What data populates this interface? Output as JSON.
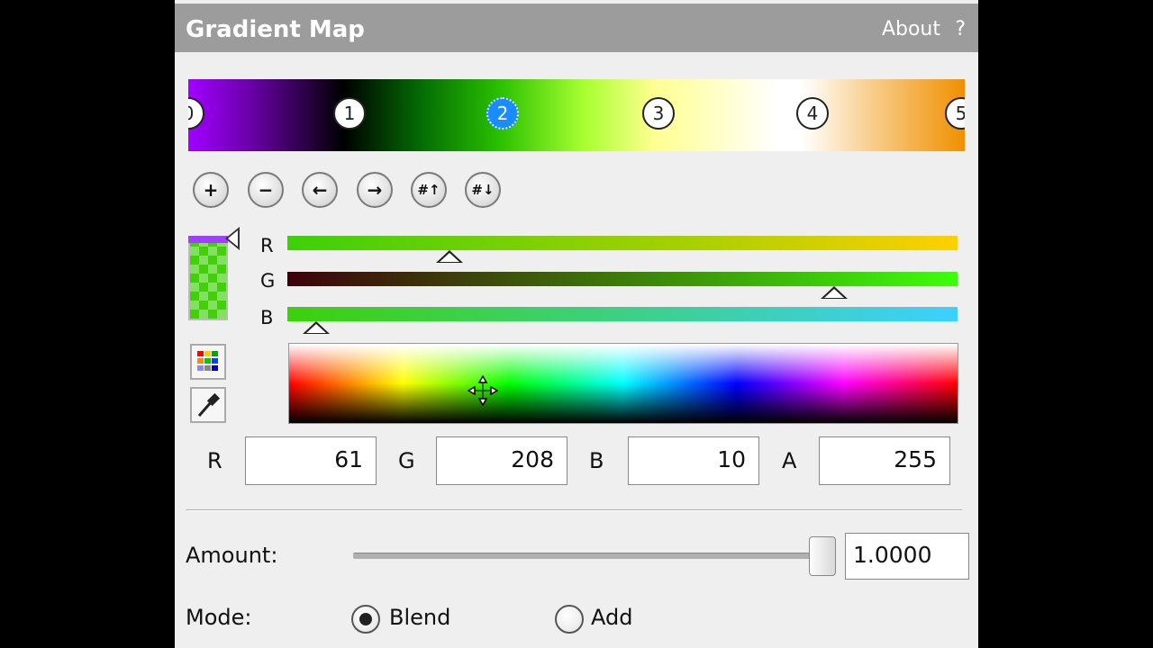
{
  "window": {
    "title": "Gradient Map",
    "about_label": "About",
    "help_label": "?"
  },
  "gradient": {
    "stops": [
      {
        "label": "0",
        "color": "#a000ff",
        "active": false
      },
      {
        "label": "1",
        "color": "#000000",
        "active": false
      },
      {
        "label": "2",
        "color": "#3dd00a",
        "active": true
      },
      {
        "label": "3",
        "color": "#ffff90",
        "active": false
      },
      {
        "label": "4",
        "color": "#ffffff",
        "active": false
      },
      {
        "label": "5",
        "color": "#f09000",
        "active": false
      }
    ]
  },
  "toolbar": {
    "buttons": [
      {
        "name": "add-stop-icon",
        "glyph": "+"
      },
      {
        "name": "remove-stop-icon",
        "glyph": "−"
      },
      {
        "name": "move-left-icon",
        "glyph": "←"
      },
      {
        "name": "move-right-icon",
        "glyph": "→"
      },
      {
        "name": "stop-up-icon",
        "glyph": "#↑"
      },
      {
        "name": "stop-down-icon",
        "glyph": "#↓"
      }
    ]
  },
  "channels": {
    "r_label": "R",
    "g_label": "G",
    "b_label": "B"
  },
  "side_buttons": {
    "palette_icon": "palette-icon",
    "eyedropper_icon": "eyedropper-icon"
  },
  "values": {
    "r_label": "R",
    "r_value": "61",
    "g_label": "G",
    "g_value": "208",
    "b_label": "B",
    "b_value": "10",
    "a_label": "A",
    "a_value": "255"
  },
  "amount": {
    "label": "Amount:",
    "value": "1.0000",
    "slider_fraction": 1.0
  },
  "mode": {
    "label": "Mode:",
    "options": [
      "Blend",
      "Add"
    ],
    "selected": "Blend"
  },
  "colors": {
    "selected_color": "#3dd00a",
    "title_bar": "#9c9c9c",
    "active_stop": "#1a8cff"
  }
}
